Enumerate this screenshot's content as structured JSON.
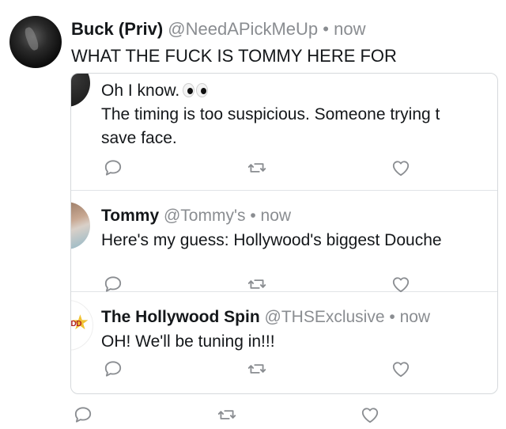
{
  "tweet": {
    "display_name": "Buck (Priv)",
    "handle": "@NeedAPickMeUp",
    "separator": "•",
    "time": "now",
    "text": "WHAT THE FUCK IS TOMMY HERE FOR"
  },
  "thread": [
    {
      "line1": "Oh I know.",
      "emoji": "eyes-emoji",
      "line2": "The timing is too suspicious. Someone trying t",
      "line3": "save face."
    },
    {
      "display_name": "Tommy",
      "handle": "@Tommy's",
      "separator": "•",
      "time": "now",
      "text": "Here's my guess: Hollywood's biggest Douche"
    },
    {
      "display_name": "The Hollywood Spin",
      "handle": "@THSExclusive",
      "separator": "•",
      "time": "now",
      "text": "OH! We'll be tuning in!!!",
      "avatar_text": "ODD"
    }
  ],
  "icons": {
    "reply": "comment-icon",
    "retweet": "retweet-icon",
    "like": "heart-icon"
  },
  "colors": {
    "muted": "#8a8d91",
    "icon": "#8a8d91",
    "border": "#d6d9dc"
  }
}
